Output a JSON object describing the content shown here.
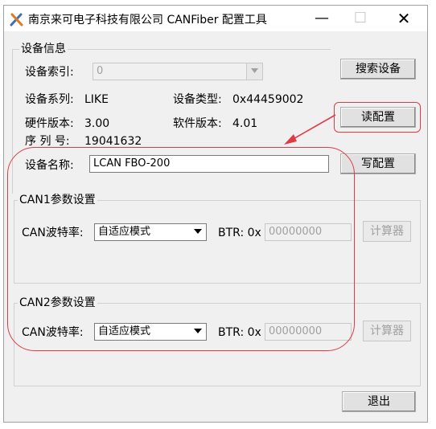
{
  "window": {
    "title": "南京来可电子科技有限公司 CANFiber 配置工具",
    "min_symbol": "—",
    "max_symbol": "☐",
    "close_symbol": "✕"
  },
  "device_info": {
    "group_title": "设备信息",
    "index_label": "设备索引:",
    "index_value": "0",
    "series_label": "设备系列:",
    "series_value": "LIKE",
    "type_label": "设备类型:",
    "type_value": "0x44459002",
    "hw_label": "硬件版本:",
    "hw_value": "3.00",
    "sw_label": "软件版本:",
    "sw_value": "4.01",
    "serial_label": "序 列 号:",
    "serial_value": "19041632",
    "name_label": "设备名称:",
    "name_value": "LCAN FBO-200"
  },
  "buttons": {
    "search": "搜索设备",
    "read": "读配置",
    "write": "写配置",
    "exit": "退出"
  },
  "can1": {
    "group_title": "CAN1参数设置",
    "baud_label": "CAN波特率:",
    "baud_value": "自适应模式",
    "btr_label": "BTR: 0x",
    "btr_value": "00000000",
    "calc": "计算器"
  },
  "can2": {
    "group_title": "CAN2参数设置",
    "baud_label": "CAN波特率:",
    "baud_value": "自适应模式",
    "btr_label": "BTR: 0x",
    "btr_value": "00000000",
    "calc": "计算器"
  },
  "colors": {
    "annotation": "#e13a45"
  }
}
